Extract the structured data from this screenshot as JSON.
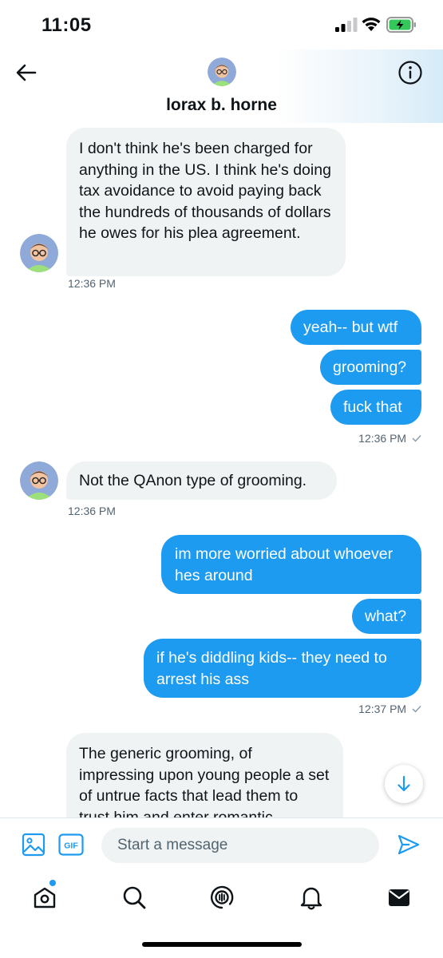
{
  "status_bar": {
    "time": "11:05",
    "icons": [
      "signal-icon",
      "wifi-icon",
      "battery-charging-icon"
    ]
  },
  "header": {
    "contact_name": "lorax b. horne",
    "icons": [
      "back-arrow-icon",
      "info-icon"
    ]
  },
  "messages": [
    {
      "direction": "in",
      "text": "I don't think he's been charged for anything in the US. I think he's doing tax avoidance to avoid paying back the hundreds of thousands of dollars he owes for his plea agreement."
    },
    {
      "direction": "in",
      "time": "12:36 PM"
    },
    {
      "direction": "out",
      "text": "yeah-- but wtf"
    },
    {
      "direction": "out",
      "text": "grooming?"
    },
    {
      "direction": "out",
      "text": "fuck that",
      "time": "12:36 PM"
    },
    {
      "direction": "in",
      "text": "Not the QAnon type of grooming.",
      "time": "12:36 PM"
    },
    {
      "direction": "out",
      "text": "im more worried about whoever hes around"
    },
    {
      "direction": "out",
      "text": "what?"
    },
    {
      "direction": "out",
      "text": "if he's diddling kids-- they need to arrest his ass",
      "time": "12:37 PM"
    },
    {
      "direction": "in",
      "text": "The generic grooming, of impressing upon young people a set of untrue facts that lead them to trust him and enter romantic"
    }
  ],
  "composer": {
    "placeholder": "Start a message",
    "icons": [
      "image-icon",
      "gif-icon",
      "send-icon"
    ],
    "gif_label": "GIF"
  },
  "bottom_nav": {
    "items": [
      "home-icon",
      "search-icon",
      "spaces-icon",
      "notifications-icon",
      "messages-icon"
    ],
    "home_has_notification_dot": true
  },
  "colors": {
    "accent": "#1d9bf0",
    "incoming_bubble": "#eff3f4",
    "timestamp": "#536471",
    "text": "#0f1419"
  }
}
